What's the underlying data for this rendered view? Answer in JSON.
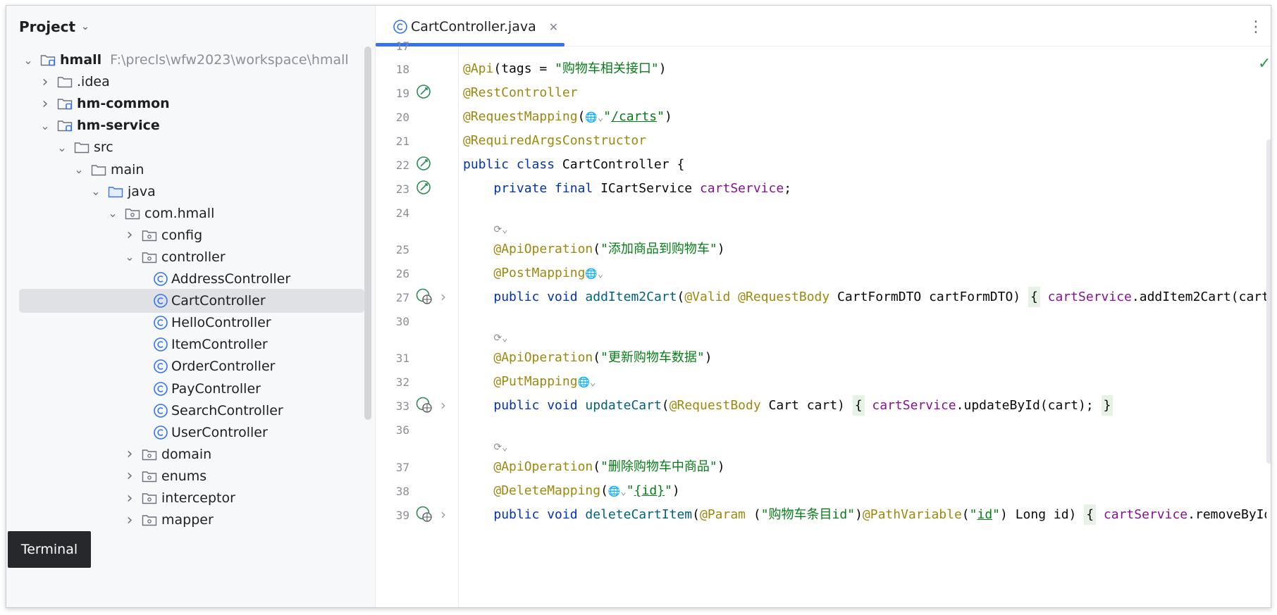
{
  "project_panel": {
    "title": "Project",
    "tree": [
      {
        "label": "hmall",
        "path": "F:\\precls\\wfw2023\\workspace\\hmall",
        "kind": "module",
        "expanded": true,
        "bold": true
      },
      {
        "label": ".idea",
        "kind": "folder",
        "expanded": false
      },
      {
        "label": "hm-common",
        "kind": "module",
        "expanded": false,
        "bold": true
      },
      {
        "label": "hm-service",
        "kind": "module",
        "expanded": true,
        "bold": true
      },
      {
        "label": "src",
        "kind": "folder",
        "expanded": true
      },
      {
        "label": "main",
        "kind": "folder",
        "expanded": true
      },
      {
        "label": "java",
        "kind": "source-folder",
        "expanded": true
      },
      {
        "label": "com.hmall",
        "kind": "package",
        "expanded": true
      },
      {
        "label": "config",
        "kind": "package",
        "expanded": false
      },
      {
        "label": "controller",
        "kind": "package",
        "expanded": true
      },
      {
        "label": "AddressController",
        "kind": "class"
      },
      {
        "label": "CartController",
        "kind": "class",
        "selected": true
      },
      {
        "label": "HelloController",
        "kind": "class"
      },
      {
        "label": "ItemController",
        "kind": "class"
      },
      {
        "label": "OrderController",
        "kind": "class"
      },
      {
        "label": "PayController",
        "kind": "class"
      },
      {
        "label": "SearchController",
        "kind": "class"
      },
      {
        "label": "UserController",
        "kind": "class"
      },
      {
        "label": "domain",
        "kind": "package",
        "expanded": false
      },
      {
        "label": "enums",
        "kind": "package",
        "expanded": false
      },
      {
        "label": "interceptor",
        "kind": "package",
        "expanded": false
      },
      {
        "label": "mapper",
        "kind": "package",
        "expanded": false
      }
    ]
  },
  "terminal_tooltip": "Terminal",
  "editor": {
    "tab_label": "CartController.java",
    "line_numbers": [
      "18",
      "19",
      "20",
      "21",
      "22",
      "23",
      "24",
      "25",
      "26",
      "27",
      "30",
      "31",
      "32",
      "33",
      "36",
      "37",
      "38",
      "39"
    ],
    "top_partial_line": "17",
    "strings": {
      "api_tags": "\"购物车相关接口\"",
      "carts_path": "/carts",
      "op_add": "\"添加商品到购物车\"",
      "op_update": "\"更新购物车数据\"",
      "op_delete": "\"删除购物车中商品\"",
      "id_path": "{id}",
      "param_desc": "\"购物车条目id\"",
      "path_var": "id"
    }
  },
  "colors": {
    "annotation": "#9e880d",
    "keyword": "#0033b3",
    "string": "#067d17",
    "field": "#871094",
    "method": "#00627a",
    "accent": "#3574f0"
  }
}
